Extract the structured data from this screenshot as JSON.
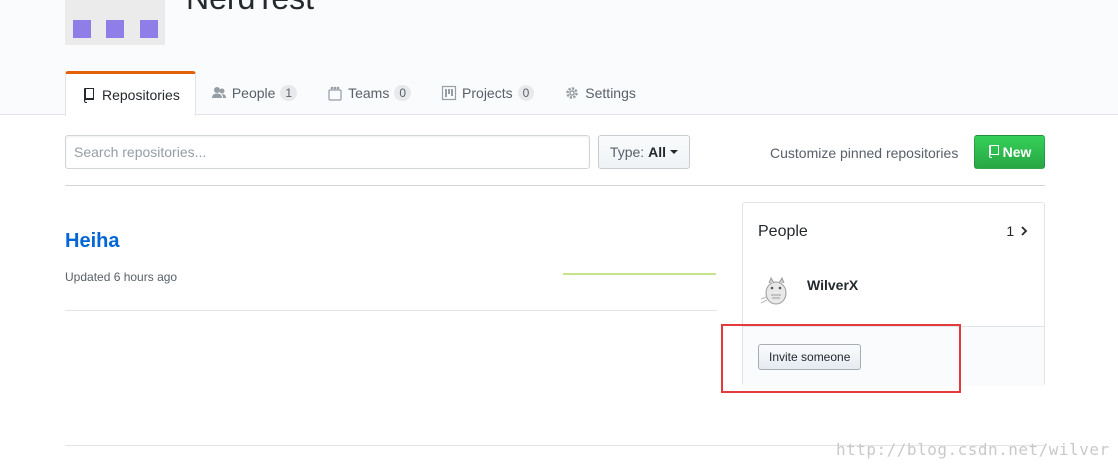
{
  "org": {
    "name": "NerdTest"
  },
  "tabs": [
    {
      "label": "Repositories",
      "icon": "repo-icon",
      "count": null,
      "selected": true
    },
    {
      "label": "People",
      "icon": "people-icon",
      "count": "1"
    },
    {
      "label": "Teams",
      "icon": "teams-icon",
      "count": "0"
    },
    {
      "label": "Projects",
      "icon": "project-icon",
      "count": "0"
    },
    {
      "label": "Settings",
      "icon": "gear-icon",
      "count": null
    }
  ],
  "toolbar": {
    "search_placeholder": "Search repositories...",
    "type_label": "Type:",
    "type_value": "All",
    "pin_link": "Customize pinned repositories",
    "new_label": "New"
  },
  "repos": [
    {
      "name": "Heiha",
      "updated": "Updated 6 hours ago"
    }
  ],
  "people_box": {
    "title": "People",
    "count": "1",
    "members": [
      {
        "name": "WilverX"
      }
    ],
    "invite_label": "Invite someone"
  },
  "colors": {
    "accent_tab": "#e36209",
    "link": "#0366d6",
    "new_button": "#28a745",
    "highlight": "#e33b3b",
    "avatar_squares": "#8f7ee7"
  },
  "watermark": "http://blog.csdn.net/wilver"
}
